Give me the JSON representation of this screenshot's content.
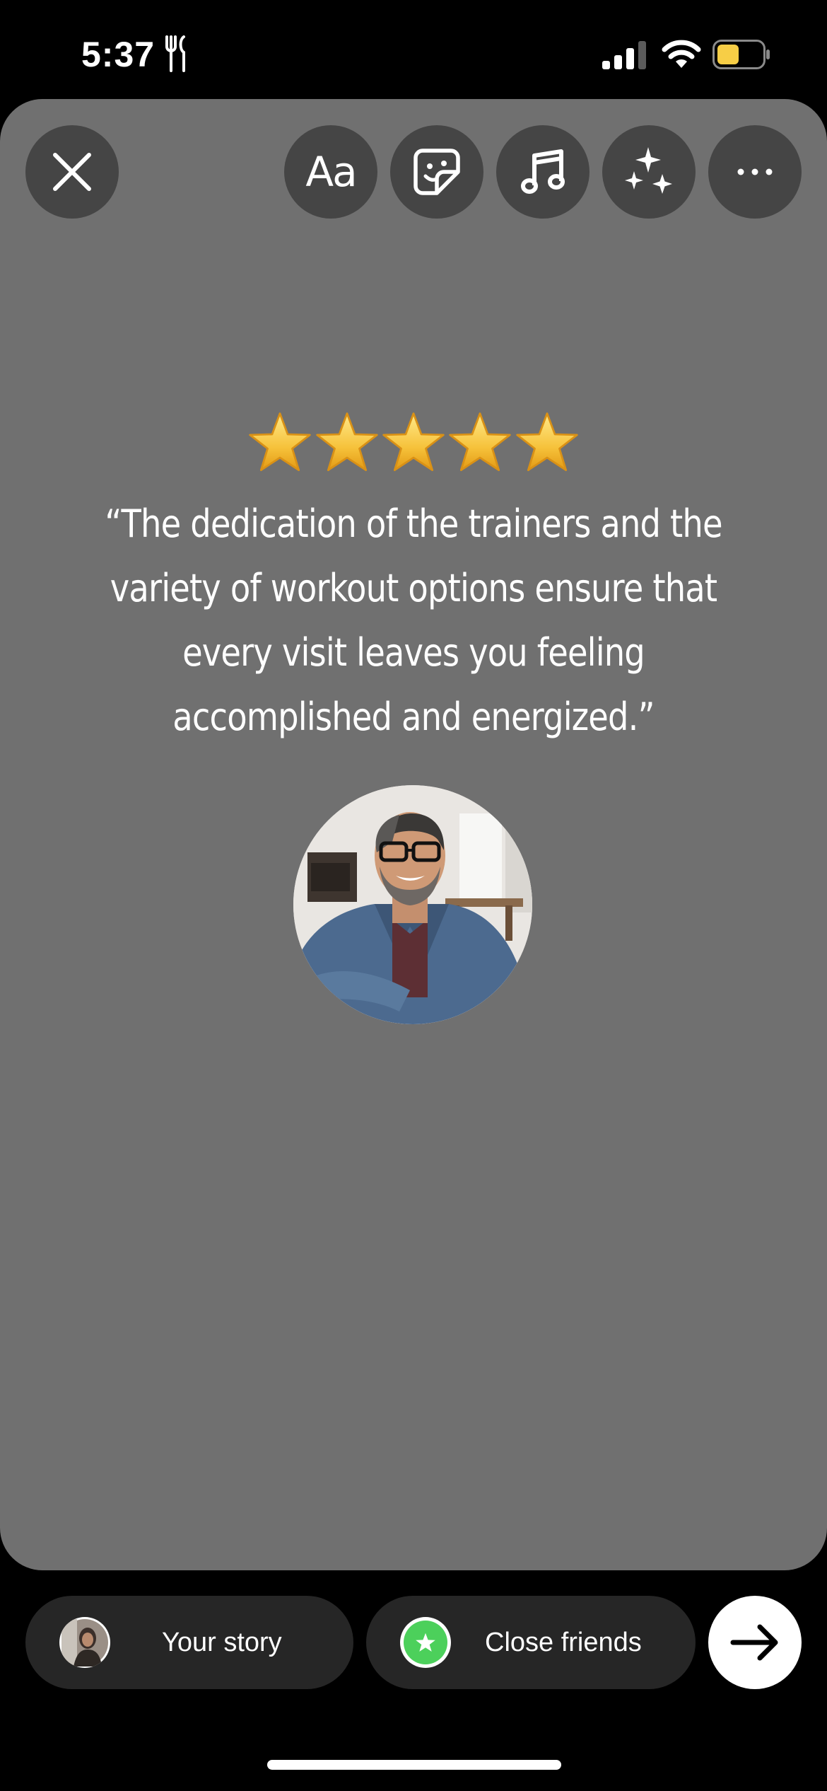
{
  "status_bar": {
    "time": "5:37",
    "icons": [
      "fork-knife-icon",
      "cellular-signal-icon",
      "wifi-icon",
      "battery-icon"
    ],
    "battery_color": "#f7ce46"
  },
  "toolbar": {
    "close_icon": "close-icon",
    "text_label": "Aa",
    "sticker_icon": "sticker-icon",
    "music_icon": "music-note-icon",
    "effects_icon": "sparkles-icon",
    "more_icon": "more-icon"
  },
  "story": {
    "background_color": "#707070",
    "rating": 5,
    "quote": "“The dedication of the trainers and the variety of workout options ensure that every visit leaves you feeling accomplished and energized.”",
    "photo": "testimonial-photo"
  },
  "share": {
    "your_story_label": "Your story",
    "close_friends_label": "Close friends",
    "close_friends_color": "#4cd05b",
    "next_icon": "arrow-right-icon"
  }
}
